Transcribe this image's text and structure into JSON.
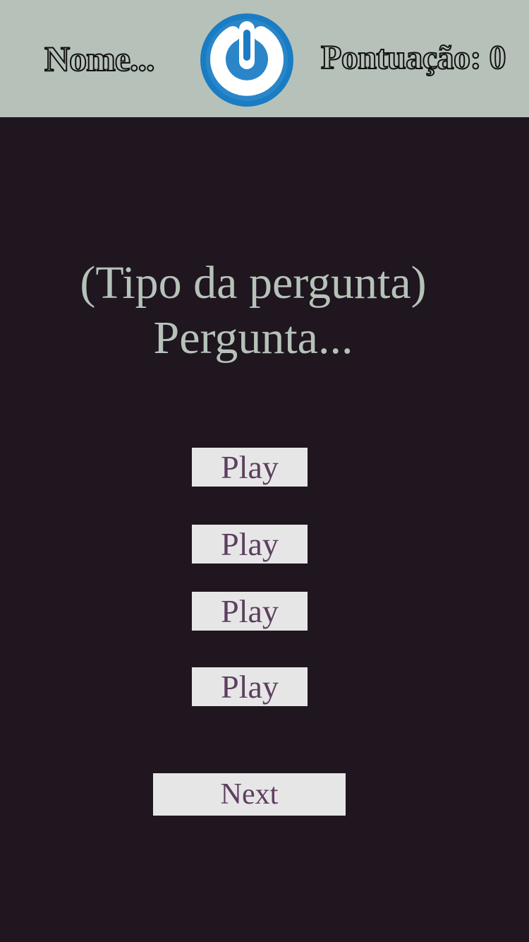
{
  "header": {
    "player_name": "Nome...",
    "score_text": "Pontuação: 0",
    "logo_icon": "power-icon",
    "colors": {
      "background": "#b6c2b9",
      "logo_ring": "#1a7cc3"
    }
  },
  "question": {
    "type_label": "(Tipo da pergunta)",
    "text": "Pergunta..."
  },
  "answers": [
    {
      "label": "Play"
    },
    {
      "label": "Play"
    },
    {
      "label": "Play"
    },
    {
      "label": "Play"
    }
  ],
  "next_label": "Next",
  "colors": {
    "page_background": "#1f161f",
    "button_background": "#e6e6e6",
    "button_text": "#5d3f5f",
    "question_text": "#b6c2b9"
  }
}
